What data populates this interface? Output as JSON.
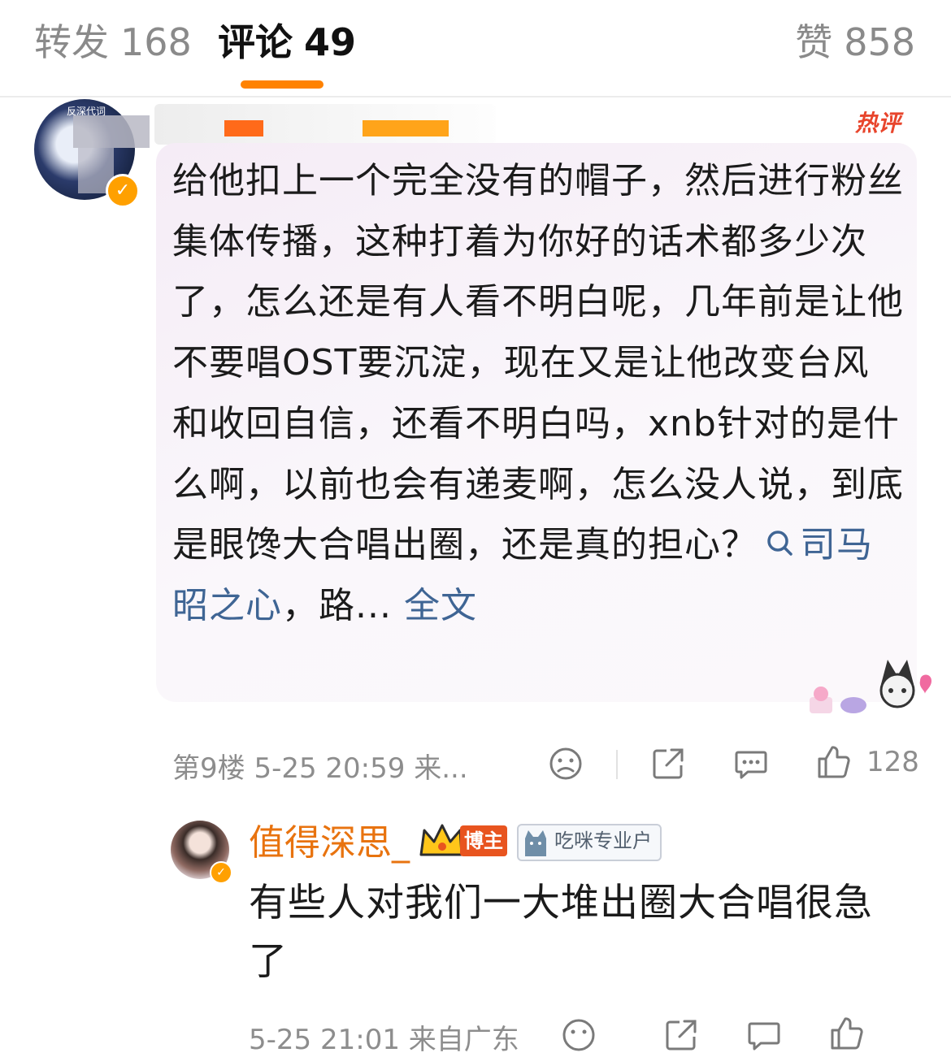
{
  "tabs": {
    "repost": {
      "label": "转发",
      "count": "168"
    },
    "comments": {
      "label": "评论",
      "count": "49",
      "active": true
    },
    "likes": {
      "label": "赞",
      "count": "858"
    }
  },
  "hot_comment": {
    "hot_label": "热评",
    "text_main": "给他扣上一个完全没有的帽子，然后进行粉丝集体传播，这种打着为你好的话术都多少次了，怎么还是有人看不明白呢，几年前是让他不要唱OST要沉淀，现在又是让他改变台风和收回自信，还看不明白吗，xnb针对的是什么啊，以前也会有递麦啊，怎么没人说，到底是眼馋大合唱出圈，还是真的担心？",
    "topic_link": "司马昭之心",
    "text_tail": "，路...",
    "fulltext_label": "全文",
    "meta": "第9楼  5-25 20:59  来...",
    "like_count": "128"
  },
  "reply": {
    "author": "值得深思_",
    "badge_blogger": "博主",
    "badge_pro": "吃咪专业户",
    "text": "有些人对我们一大堆出圈大合唱很急了",
    "meta": "5-25 21:01  来自广东"
  },
  "colors": {
    "accent": "#ff8200",
    "link": "#3f6594",
    "author": "#e8730f",
    "hot": "#e8452c"
  }
}
